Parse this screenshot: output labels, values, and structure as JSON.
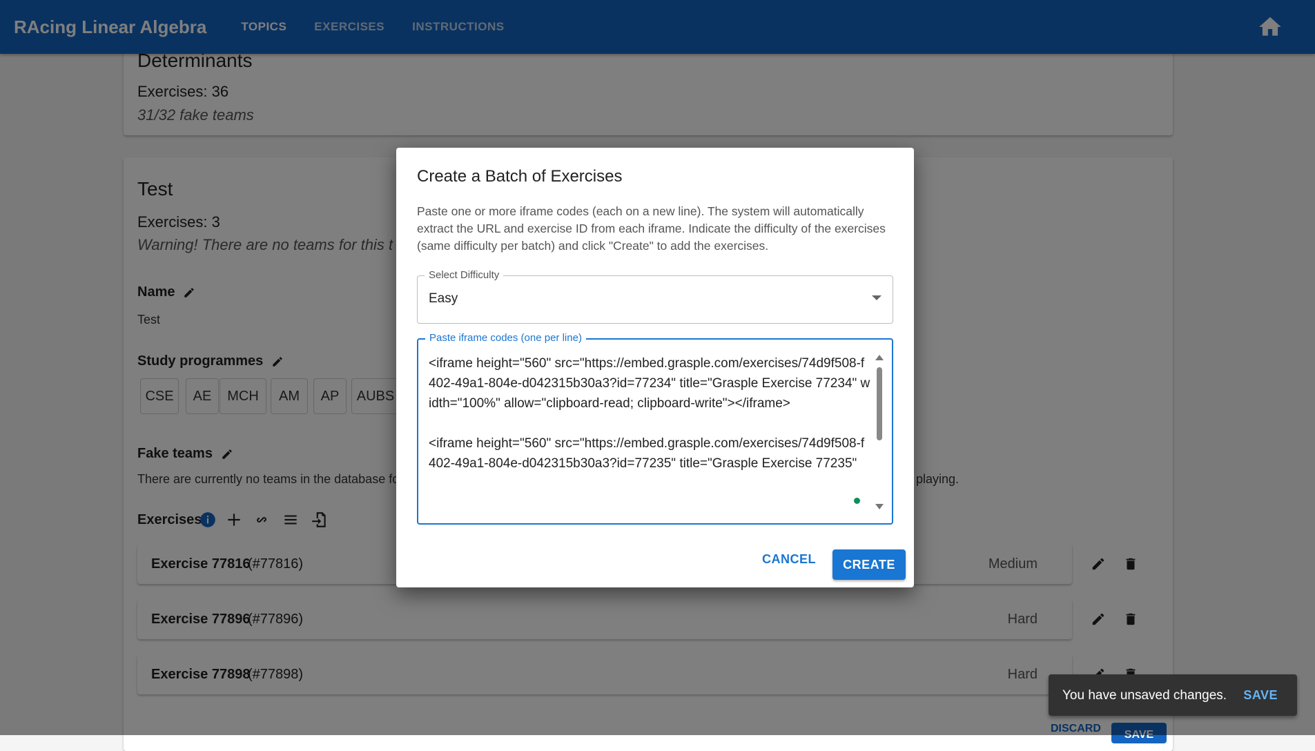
{
  "appbar": {
    "brand": "RAcing Linear Algebra",
    "nav": [
      "TOPICS",
      "EXERCISES",
      "INSTRUCTIONS"
    ],
    "home_icon": "home-icon",
    "color": "#1565c0"
  },
  "topic_determinants": {
    "title": "Determinants",
    "exercises": "Exercises: 36",
    "teams": "31/32 fake teams"
  },
  "topic_test": {
    "title": "Test",
    "exercises": "Exercises: 3",
    "warning": "Warning! There are no teams for this t",
    "name_label": "Name",
    "name_value": "Test",
    "programmes_label": "Study programmes",
    "programmes": [
      "CSE",
      "AE",
      "MCH",
      "AM",
      "AP",
      "AUBS"
    ],
    "fake_teams_label": "Fake teams",
    "fake_teams_text_left": "There are currently no teams in the database fo",
    "fake_teams_text_right": "playing.",
    "exercises_label": "Exercises",
    "exercise_rows": [
      {
        "name": "Exercise 77816",
        "id": "(#77816)",
        "difficulty": "Medium"
      },
      {
        "name": "Exercise 77896",
        "id": "(#77896)",
        "difficulty": "Hard"
      },
      {
        "name": "Exercise 77898",
        "id": "(#77898)",
        "difficulty": "Hard"
      }
    ],
    "discard": "DISCARD",
    "save": "SAVE"
  },
  "dialog": {
    "title": "Create a Batch of Exercises",
    "description": "Paste one or more iframe codes (each on a new line). The system will automatically extract the URL and exercise ID from each iframe. Indicate the difficulty of the exercises (same difficulty per batch) and click \"Create\" to add the exercises.",
    "select_label": "Select Difficulty",
    "select_value": "Easy",
    "textarea_label": "Paste iframe codes (one per line)",
    "textarea_value": "<iframe height=\"560\" src=\"https://embed.grasple.com/exercises/74d9f508-f402-49a1-804e-d042315b30a3?id=77234\" title=\"Grasple Exercise 77234\" width=\"100%\" allow=\"clipboard-read; clipboard-write\"></iframe>\n\n<iframe height=\"560\" src=\"https://embed.grasple.com/exercises/74d9f508-f402-49a1-804e-d042315b30a3?id=77235\" title=\"Grasple Exercise 77235\"",
    "cancel": "CANCEL",
    "create": "CREATE",
    "accent": "#1976d2"
  },
  "snackbar": {
    "message": "You have unsaved changes.",
    "action": "SAVE"
  }
}
